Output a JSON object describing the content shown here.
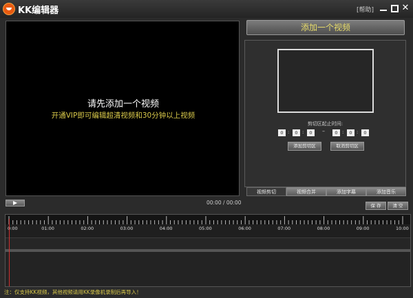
{
  "title_bar": {
    "app_title": "KK编辑器",
    "help_label": "[帮助]",
    "close_glyph": "✕"
  },
  "preview": {
    "headline": "请先添加一个视频",
    "subline": "开通VIP即可编辑超清视频和30分钟以上视频",
    "time_readout": "00:00 / 00:00"
  },
  "right_panel": {
    "add_video_label": "添加一个视频",
    "clip_range_label": "剪切区起止时间:",
    "start_time": [
      "0",
      "0",
      "0"
    ],
    "end_time": [
      "0",
      "0",
      "0"
    ],
    "separator": ":",
    "dash": "–",
    "add_clip_label": "添加剪切区",
    "cancel_clip_label": "取消剪切区",
    "tabs": [
      {
        "label": "视频剪切",
        "active": true
      },
      {
        "label": "视频合并",
        "active": false
      },
      {
        "label": "添加字幕",
        "active": false
      },
      {
        "label": "添加音乐",
        "active": false
      }
    ]
  },
  "actions": {
    "save_label": "保 存",
    "clear_label": "清 空"
  },
  "timeline": {
    "tick_labels": [
      "0:00",
      "01:00",
      "02:00",
      "03:00",
      "04:00",
      "05:00",
      "06:00",
      "07:00",
      "08:00",
      "09:00",
      "10:00"
    ]
  },
  "footnote": "注：仅支持KK视频，其他视频请用KK录像机录制后再导入！",
  "colors": {
    "accent_text": "#d9c94a",
    "playhead": "#d03030"
  }
}
